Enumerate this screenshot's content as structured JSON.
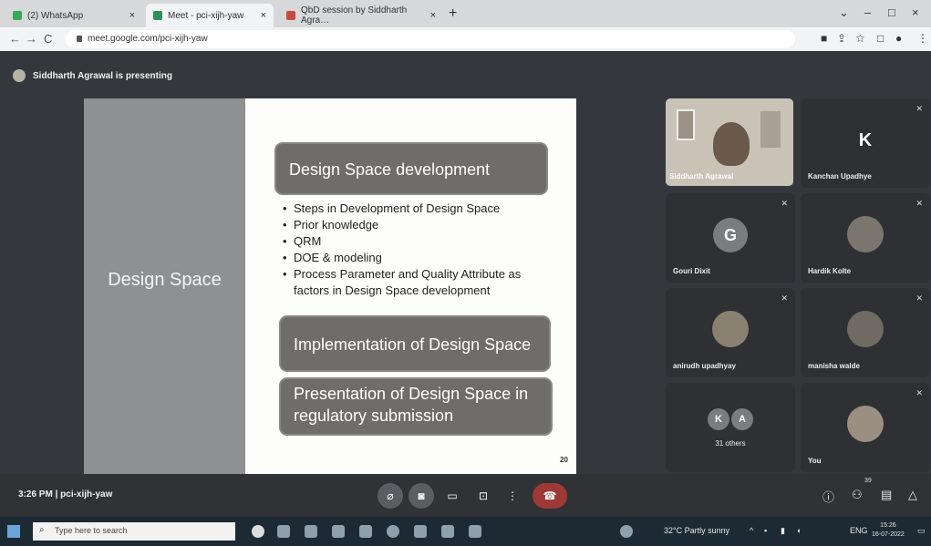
{
  "browser": {
    "tabs": [
      {
        "title": "(2) WhatsApp",
        "close": "×"
      },
      {
        "title": "Meet - pci-xijh-yaw",
        "close": "×"
      },
      {
        "title": "QbD session by Siddharth Agra…",
        "close": "×"
      }
    ],
    "new_tab": "+",
    "url": "meet.google.com/pci-xijh-yaw",
    "window_controls": {
      "minimize": "–",
      "maximize": "□",
      "close": "×"
    },
    "nav": {
      "back": "←",
      "forward": "→",
      "reload": "C"
    }
  },
  "meet": {
    "presenting_text": "Siddharth Agrawal is presenting",
    "meeting_time": "3:26 PM",
    "meeting_code": "pci-xijh-yaw",
    "participant_badge": "39"
  },
  "slide": {
    "left_title": "Design Space",
    "box1": "Design Space development",
    "bullets": [
      "Steps in Development of Design Space",
      "Prior knowledge",
      "QRM",
      "DOE & modeling",
      "Process Parameter and Quality Attribute as factors in Design Space development"
    ],
    "box2": "Implementation of Design Space",
    "box3": "Presentation of Design Space in regulatory submission",
    "page_number": "20"
  },
  "participants": [
    {
      "name": "Siddharth Agrawal",
      "initial": ""
    },
    {
      "name": "Kanchan Upadhye",
      "initial": "K"
    },
    {
      "name": "Gouri Dixit",
      "initial": "G"
    },
    {
      "name": "Hardik Kolte",
      "initial": ""
    },
    {
      "name": "anirudh upadhyay",
      "initial": ""
    },
    {
      "name": "manisha walde",
      "initial": ""
    },
    {
      "name": "31 others",
      "initial_a": "K",
      "initial_b": "A"
    },
    {
      "name": "You",
      "initial": ""
    }
  ],
  "taskbar": {
    "search_placeholder": "Type here to search",
    "weather": "32°C  Partly sunny",
    "language": "ENG",
    "time": "15:26",
    "date": "16-07-2022"
  }
}
